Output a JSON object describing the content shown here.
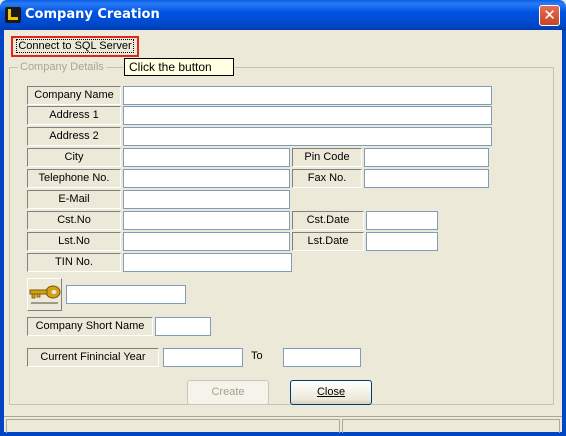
{
  "window": {
    "title": "Company Creation",
    "close_glyph": "✕"
  },
  "toolbar": {
    "connect_label": "Connect to SQL Server",
    "tooltip": "Click the button"
  },
  "group": {
    "legend": "Company Details"
  },
  "form": {
    "company_name": {
      "label": "Company Name",
      "value": ""
    },
    "address1": {
      "label": "Address 1",
      "value": ""
    },
    "address2": {
      "label": "Address 2",
      "value": ""
    },
    "city": {
      "label": "City",
      "value": ""
    },
    "pin_code": {
      "label": "Pin Code",
      "value": ""
    },
    "telephone": {
      "label": "Telephone No.",
      "value": ""
    },
    "fax": {
      "label": "Fax No.",
      "value": ""
    },
    "email": {
      "label": "E-Mail",
      "value": ""
    },
    "cst_no": {
      "label": "Cst.No",
      "value": ""
    },
    "cst_date": {
      "label": "Cst.Date",
      "value": ""
    },
    "lst_no": {
      "label": "Lst.No",
      "value": ""
    },
    "lst_date": {
      "label": "Lst.Date",
      "value": ""
    },
    "tin_no": {
      "label": "TIN No.",
      "value": ""
    },
    "key_value": "",
    "short_name": {
      "label": "Company Short Name",
      "value": ""
    },
    "fin_year": {
      "label": "Current Finincial Year",
      "from": "",
      "to_label": "To",
      "to": ""
    }
  },
  "actions": {
    "create_label": "Create",
    "close_label": "Close"
  },
  "icons": {
    "app": "app-icon",
    "key": "key-icon",
    "close": "close-icon"
  },
  "colors": {
    "title_bar": "#0054e3",
    "highlight_border": "#e0271e",
    "tooltip_bg": "#ffffe1",
    "window_bg": "#ece9d8"
  }
}
